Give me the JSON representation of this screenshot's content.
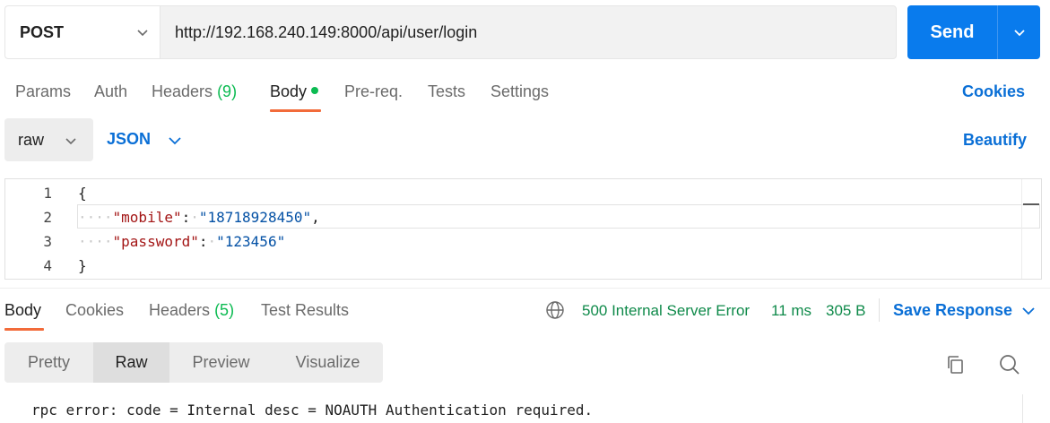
{
  "request": {
    "method": "POST",
    "url": "http://192.168.240.149:8000/api/user/login",
    "send_label": "Send"
  },
  "request_tabs": {
    "params": "Params",
    "auth": "Auth",
    "headers": "Headers",
    "headers_count": "(9)",
    "body": "Body",
    "prereq": "Pre-req.",
    "tests": "Tests",
    "settings": "Settings",
    "cookies_link": "Cookies"
  },
  "body_options": {
    "mode": "raw",
    "language": "JSON",
    "beautify": "Beautify"
  },
  "editor": {
    "lines": [
      {
        "num": "1",
        "brace": "{"
      },
      {
        "num": "2",
        "key": "\"mobile\"",
        "value": "\"18718928450\"",
        "trail": ","
      },
      {
        "num": "3",
        "key": "\"password\"",
        "value": "\"123456\"",
        "trail": ""
      },
      {
        "num": "4",
        "brace": "}"
      }
    ]
  },
  "response_tabs": {
    "body": "Body",
    "cookies": "Cookies",
    "headers": "Headers",
    "headers_count": "(5)",
    "test_results": "Test Results"
  },
  "response_status": {
    "status": "500 Internal Server Error",
    "time": "11 ms",
    "size": "305 B",
    "save": "Save Response"
  },
  "response_view": {
    "pretty": "Pretty",
    "raw": "Raw",
    "preview": "Preview",
    "visualize": "Visualize",
    "active": "Raw"
  },
  "response_body": "rpc error: code = Internal desc = NOAUTH Authentication required.",
  "colors": {
    "accent": "#097bed",
    "tab_underline": "#f26b3a",
    "success_green": "#0cbb52",
    "status_text": "#0f8a4a",
    "link_blue": "#0a6fd6"
  }
}
